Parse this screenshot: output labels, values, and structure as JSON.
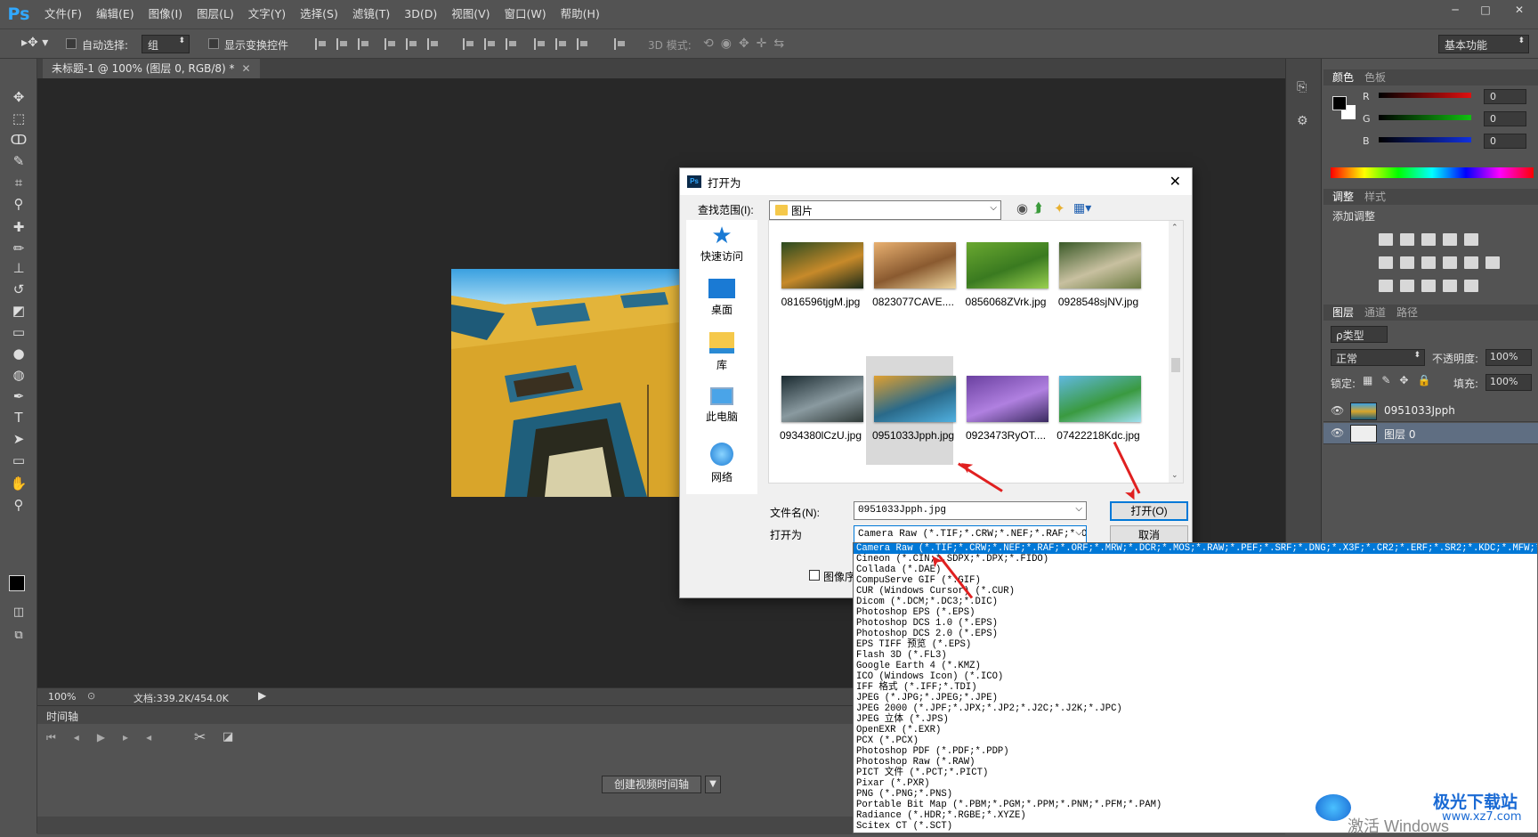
{
  "app": {
    "logo": "Ps"
  },
  "menu": [
    "文件(F)",
    "编辑(E)",
    "图像(I)",
    "图层(L)",
    "文字(Y)",
    "选择(S)",
    "滤镜(T)",
    "3D(D)",
    "视图(V)",
    "窗口(W)",
    "帮助(H)"
  ],
  "window_controls": [
    "─",
    "□",
    "✕"
  ],
  "options": {
    "auto_select": "自动选择:",
    "group_value": "组",
    "show_transform": "显示变换控件",
    "mode_3d": "3D 模式:",
    "workspace": "基本功能"
  },
  "tools": [
    {
      "name": "move-tool-icon",
      "glyph": "✥"
    },
    {
      "name": "marquee-tool-icon",
      "glyph": "⬚"
    },
    {
      "name": "lasso-tool-icon",
      "glyph": "ↀ"
    },
    {
      "name": "quick-select-icon",
      "glyph": "✎"
    },
    {
      "name": "crop-tool-icon",
      "glyph": "⌗"
    },
    {
      "name": "eyedropper-icon",
      "glyph": "⚲"
    },
    {
      "name": "healing-brush-icon",
      "glyph": "✚"
    },
    {
      "name": "brush-tool-icon",
      "glyph": "✏"
    },
    {
      "name": "stamp-tool-icon",
      "glyph": "⊥"
    },
    {
      "name": "history-brush-icon",
      "glyph": "↺"
    },
    {
      "name": "eraser-icon",
      "glyph": "◩"
    },
    {
      "name": "gradient-icon",
      "glyph": "▭"
    },
    {
      "name": "blur-icon",
      "glyph": "●"
    },
    {
      "name": "dodge-icon",
      "glyph": "◍"
    },
    {
      "name": "pen-tool-icon",
      "glyph": "✒"
    },
    {
      "name": "type-tool-icon",
      "glyph": "T"
    },
    {
      "name": "path-select-icon",
      "glyph": "➤"
    },
    {
      "name": "shape-tool-icon",
      "glyph": "▭"
    },
    {
      "name": "hand-tool-icon",
      "glyph": "✋"
    },
    {
      "name": "zoom-tool-icon",
      "glyph": "⚲"
    }
  ],
  "document": {
    "tab_title": "未标题-1 @ 100% (图层 0, RGB/8) *",
    "zoom": "100%",
    "doc_size": "文档:339.2K/454.0K"
  },
  "timeline": {
    "title": "时间轴",
    "create_button": "创建视频时间轴"
  },
  "panels": {
    "color_tabs": [
      "颜色",
      "色板"
    ],
    "channels": [
      {
        "label": "R",
        "value": "0",
        "color": "#e01010"
      },
      {
        "label": "G",
        "value": "0",
        "color": "#10c010"
      },
      {
        "label": "B",
        "value": "0",
        "color": "#1030e0"
      }
    ],
    "adjust_tabs": [
      "调整",
      "样式"
    ],
    "adjust_title": "添加调整",
    "layer_tabs": [
      "图层",
      "通道",
      "路径"
    ],
    "kind": "ρ类型",
    "blend_mode": "正常",
    "opacity_label": "不透明度:",
    "opacity_value": "100%",
    "lock_label": "锁定:",
    "fill_label": "填充:",
    "fill_value": "100%",
    "layers": [
      {
        "name": "0951033Jpph",
        "selected": false
      },
      {
        "name": "图层 0",
        "selected": true
      }
    ]
  },
  "dialog": {
    "title": "打开为",
    "look_in_label": "查找范围(I):",
    "look_in_value": "图片",
    "places": [
      "快速访问",
      "桌面",
      "库",
      "此电脑",
      "网络"
    ],
    "files": [
      {
        "name": "0816596tjgM.jpg",
        "colors": [
          "#2a4a20",
          "#c78a2a",
          "#1a2a18"
        ]
      },
      {
        "name": "0823077CAVE....",
        "colors": [
          "#e8b070",
          "#8a5a30",
          "#f0d8a0"
        ]
      },
      {
        "name": "0856068ZVrk.jpg",
        "colors": [
          "#6aa830",
          "#3a7a20",
          "#9ad050"
        ]
      },
      {
        "name": "0928548sjNV.jpg",
        "colors": [
          "#3a5a28",
          "#c8c0a0",
          "#6a7a40"
        ]
      },
      {
        "name": "0934380lCzU.jpg",
        "colors": [
          "#1a2a30",
          "#8a9aa0",
          "#303a38"
        ]
      },
      {
        "name": "0951033Jpph.jpg",
        "colors": [
          "#e0a030",
          "#2a6a8a",
          "#50b0e0"
        ]
      },
      {
        "name": "0923473RyOT....",
        "colors": [
          "#6a40a0",
          "#b080e0",
          "#3a2a60"
        ]
      },
      {
        "name": "07422218Kdc.jpg",
        "colors": [
          "#60b8e0",
          "#3a9a40",
          "#a0e0f0"
        ]
      }
    ],
    "filename_label": "文件名(N):",
    "filename_value": "0951033Jpph.jpg",
    "open_as_label": "打开为",
    "open_as_value": "Camera Raw (*.TIF;*.CRW;*.NEF;*.RAF;*.ORI",
    "open_button": "打开(O)",
    "cancel_button": "取消",
    "sequence_label": "图像序"
  },
  "file_types": [
    "Camera Raw (*.TIF;*.CRW;*.NEF;*.RAF;*.ORF;*.MRW;*.DCR;*.MOS;*.RAW;*.PEF;*.SRF;*.DNG;*.X3F;*.CR2;*.ERF;*.SR2;*.KDC;*.MFW;*.MEF;*.ARW;*.NRW",
    "Cineon (*.CIN;*.SDPX;*.DPX;*.FIDO)",
    "Collada (*.DAE)",
    "CompuServe GIF (*.GIF)",
    "CUR (Windows Cursor) (*.CUR)",
    "Dicom (*.DCM;*.DC3;*.DIC)",
    "Photoshop EPS (*.EPS)",
    "Photoshop DCS 1.0 (*.EPS)",
    "Photoshop DCS 2.0 (*.EPS)",
    "EPS TIFF 预览 (*.EPS)",
    "Flash 3D (*.FL3)",
    "Google Earth 4 (*.KMZ)",
    "ICO (Windows Icon) (*.ICO)",
    "IFF 格式 (*.IFF;*.TDI)",
    "JPEG (*.JPG;*.JPEG;*.JPE)",
    "JPEG 2000 (*.JPF;*.JPX;*.JP2;*.J2C;*.J2K;*.JPC)",
    "JPEG 立体 (*.JPS)",
    "OpenEXR (*.EXR)",
    "PCX (*.PCX)",
    "Photoshop PDF (*.PDF;*.PDP)",
    "Photoshop Raw (*.RAW)",
    "PICT 文件 (*.PCT;*.PICT)",
    "Pixar (*.PXR)",
    "PNG (*.PNG;*.PNS)",
    "Portable Bit Map (*.PBM;*.PGM;*.PPM;*.PNM;*.PFM;*.PAM)",
    "Radiance (*.HDR;*.RGBE;*.XYZE)",
    "Scitex CT (*.SCT)"
  ],
  "watermark": {
    "text": "极光下载站",
    "url": "www.xz7.com",
    "activate": "激活 Windows"
  }
}
